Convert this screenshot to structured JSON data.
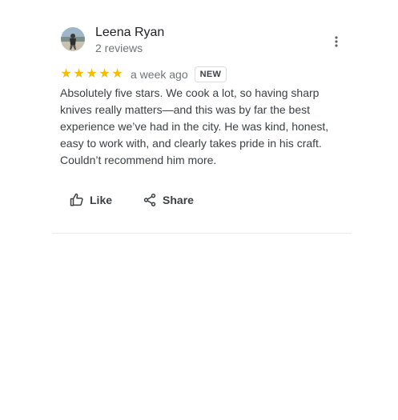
{
  "review": {
    "author": {
      "name": "Leena Ryan",
      "review_count": "2 reviews",
      "avatar_icon": "user-avatar-photo"
    },
    "rating": 5,
    "stars": [
      "★",
      "★",
      "★",
      "★",
      "★"
    ],
    "time": "a week ago",
    "badge": "NEW",
    "text": "Absolutely five stars. We cook a lot, so having sharp knives really matters—and this was by far the best experience we’ve had in the city. He was kind, honest, easy to work with, and clearly takes pride in his craft. Couldn’t recommend him more.",
    "actions": {
      "like_label": "Like",
      "share_label": "Share"
    },
    "colors": {
      "star": "#fbbc04",
      "text": "#3c4043",
      "muted": "#70757a",
      "divider": "#e8eaed"
    },
    "icons": {
      "more": "more-vert-icon",
      "like": "thumb-up-icon",
      "share": "share-icon"
    }
  }
}
